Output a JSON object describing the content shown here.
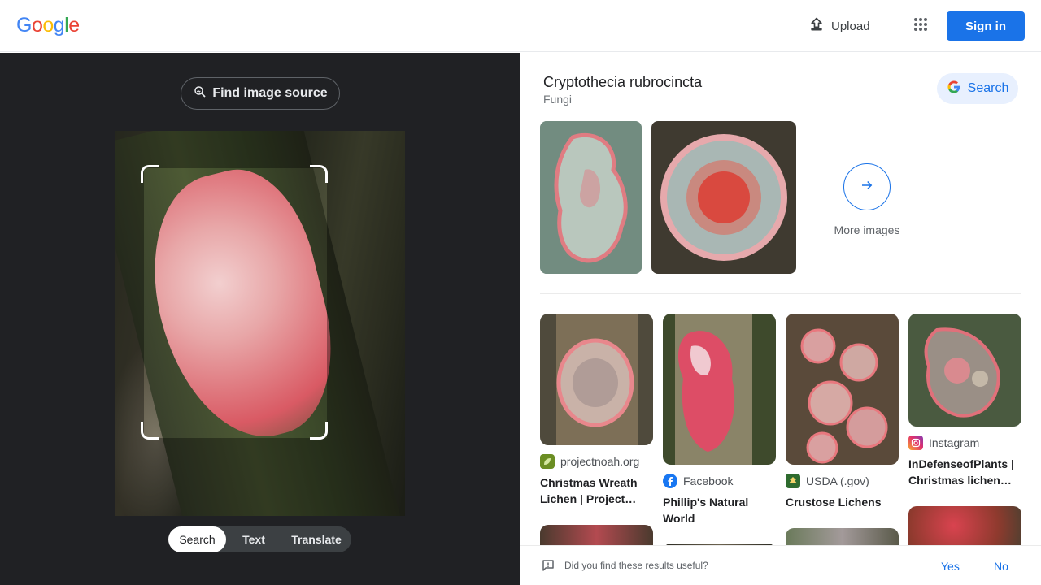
{
  "header": {
    "logo_letters": [
      "G",
      "o",
      "o",
      "g",
      "l",
      "e"
    ],
    "logo_colors": [
      "#4285f4",
      "#ea4335",
      "#fbbc05",
      "#4285f4",
      "#34a853",
      "#ea4335"
    ],
    "upload_label": "Upload",
    "signin_label": "Sign in"
  },
  "left": {
    "find_source_label": "Find image source",
    "modes": [
      {
        "label": "Search",
        "active": true
      },
      {
        "label": "Text",
        "active": false
      },
      {
        "label": "Translate",
        "active": false
      }
    ]
  },
  "entity": {
    "title": "Cryptothecia rubrocincta",
    "subtitle": "Fungi",
    "search_label": "Search",
    "more_images_label": "More images"
  },
  "results": [
    {
      "source": "projectnoah.org",
      "source_icon": "projectnoah-icon",
      "title": "Christmas Wreath Lichen | Project…"
    },
    {
      "source": "Facebook",
      "source_icon": "facebook-icon",
      "title": "Phillip's Natural World"
    },
    {
      "source": "USDA (.gov)",
      "source_icon": "usda-icon",
      "title": "Crustose Lichens"
    },
    {
      "source": "Instagram",
      "source_icon": "instagram-icon",
      "title": "InDefenseofPlants | Christmas lichen…"
    }
  ],
  "feedback": {
    "question": "Did you find these results useful?",
    "yes_label": "Yes",
    "no_label": "No"
  },
  "colors": {
    "accent": "#1a73e8",
    "dark_panel": "#202124",
    "lichen_pink": "#e07c82"
  }
}
